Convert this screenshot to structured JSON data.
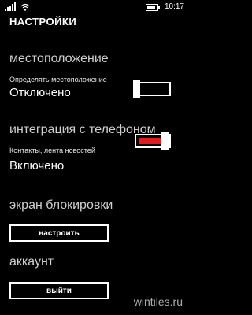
{
  "status_bar": {
    "time": "10:17",
    "signal_icon": "signal-icon",
    "wifi_icon": "wifi-icon",
    "battery_icon": "battery-icon",
    "battery_level": 0.8
  },
  "page": {
    "title": "НАСТРОЙКИ"
  },
  "location": {
    "header": "местоположение",
    "label": "Определять местоположение",
    "state": "Отключено",
    "toggle_on": false
  },
  "phone": {
    "header": "интеграция с телефоном",
    "label": "Контакты, лента новостей",
    "state": "Включено",
    "toggle_on": true
  },
  "lockscreen": {
    "header": "экран блокировки",
    "button_label": "настроить"
  },
  "account": {
    "header": "аккаунт",
    "button_label": "выйти"
  },
  "watermark": {
    "text": "wintiles.ru"
  },
  "colors": {
    "background": "#000000",
    "accent": "#e31b1b",
    "foreground": "#ffffff"
  }
}
